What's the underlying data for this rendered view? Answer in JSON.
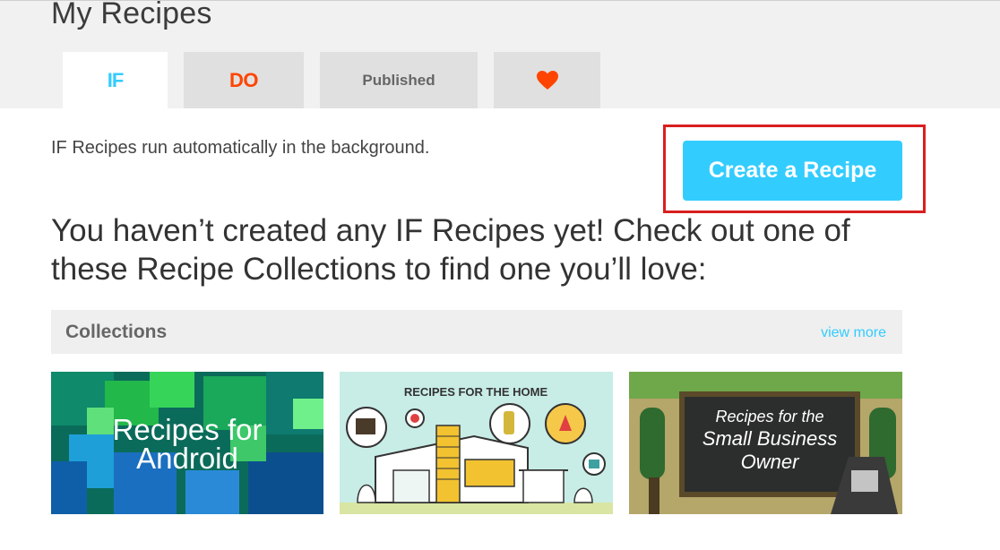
{
  "header": {
    "title": "My Recipes"
  },
  "tabs": [
    {
      "label": "IF",
      "active": true
    },
    {
      "label": "DO",
      "active": false
    },
    {
      "label": "Published",
      "active": false
    },
    {
      "icon": "heart-icon",
      "active": false
    }
  ],
  "main": {
    "description": "IF Recipes run automatically in the background.",
    "create_button": "Create a Recipe",
    "empty_message": "You haven’t created any IF Recipes yet! Check out one of these Recipe Collections to find one you’ll love:"
  },
  "collections": {
    "title": "Collections",
    "view_more": "view more",
    "cards": [
      {
        "line1": "Recipes for",
        "line2": "Android"
      },
      {
        "heading": "RECIPES FOR THE HOME"
      },
      {
        "line1": "Recipes for the",
        "line2": "Small Business",
        "line3": "Owner"
      }
    ]
  },
  "colors": {
    "accent_blue": "#33ccff",
    "do_orange": "#ff4400",
    "highlight_red": "#d81f1f"
  }
}
